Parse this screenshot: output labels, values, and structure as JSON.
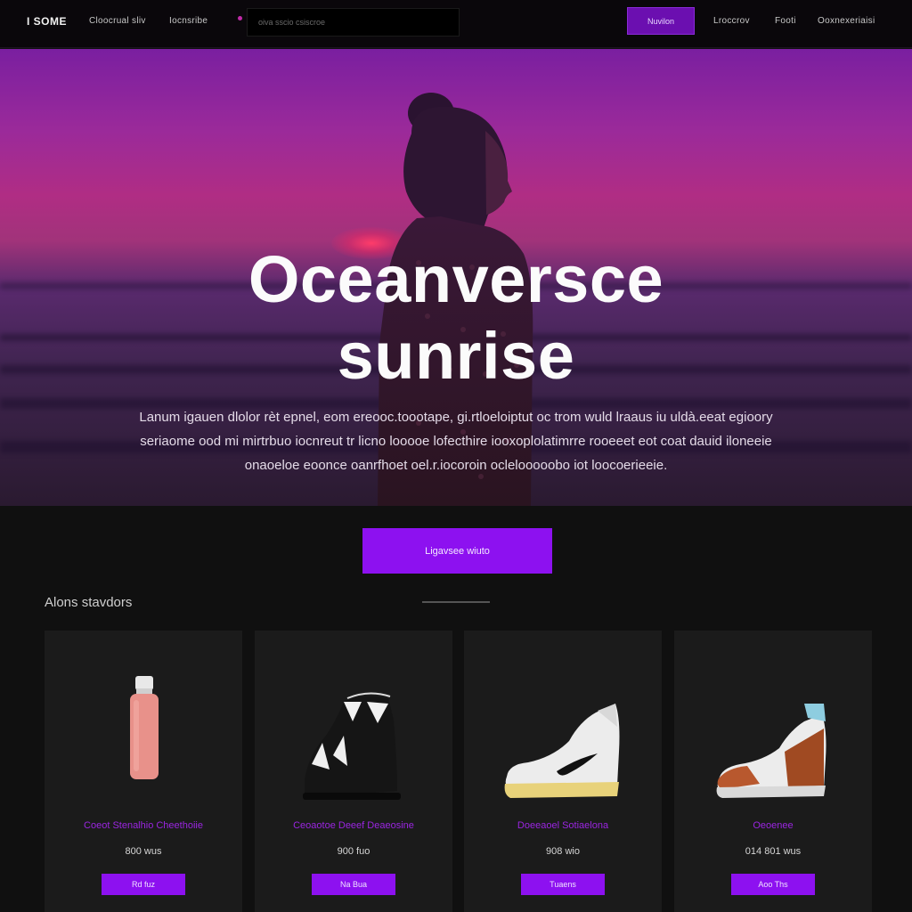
{
  "nav": {
    "logo": "I SOME",
    "links": [
      "Cloocrual sliv",
      "Iocnsribe"
    ],
    "search_placeholder": "oiva sscio csiscroe",
    "cta_label": "Nuvilon",
    "right_links": [
      "Lroccrov",
      "Footi",
      "Ooxnexeriaisi"
    ]
  },
  "hero": {
    "title_line1": "Oceanversce",
    "title_line2": "sunrise",
    "description": "Lanum igauen dlolor rèt epnel, eom ereooc.toootape, gi.rtloeloiptut oc trom wuld lraaus iu uldà.eeat egioory seriaome ood mi mirtrbuo iocnreut tr licno looooe lofecthire iooxoplolatimrre rooeeet eot coat dauid iloneeie onaoeloe eoonce oanrfhoet oel.r.iocoroin oclelooooobo iot loocoerieeie."
  },
  "main_cta_label": "Ligavsee wiuto",
  "section": {
    "title": "Alons stavdors"
  },
  "products": [
    {
      "name": "Coeot Stenalhio Cheethoiie",
      "price": "800 wus",
      "button": "Rd fuz",
      "icon": "bottle"
    },
    {
      "name": "Ceoaotoe Deeef Deaeosine",
      "price": "900 fuo",
      "button": "Na Bua",
      "icon": "boot"
    },
    {
      "name": "Doeeaoel Sotiaelona",
      "price": "908 wio",
      "button": "Tuaens",
      "icon": "sneaker-white"
    },
    {
      "name": "Oeoenee",
      "price": "014 801 wus",
      "button": "Aoo Ths",
      "icon": "sneaker-color"
    }
  ],
  "colors": {
    "accent": "#8d11f0",
    "product_name": "#9a25e0",
    "background": "#101010",
    "card": "#1b1b1b"
  }
}
